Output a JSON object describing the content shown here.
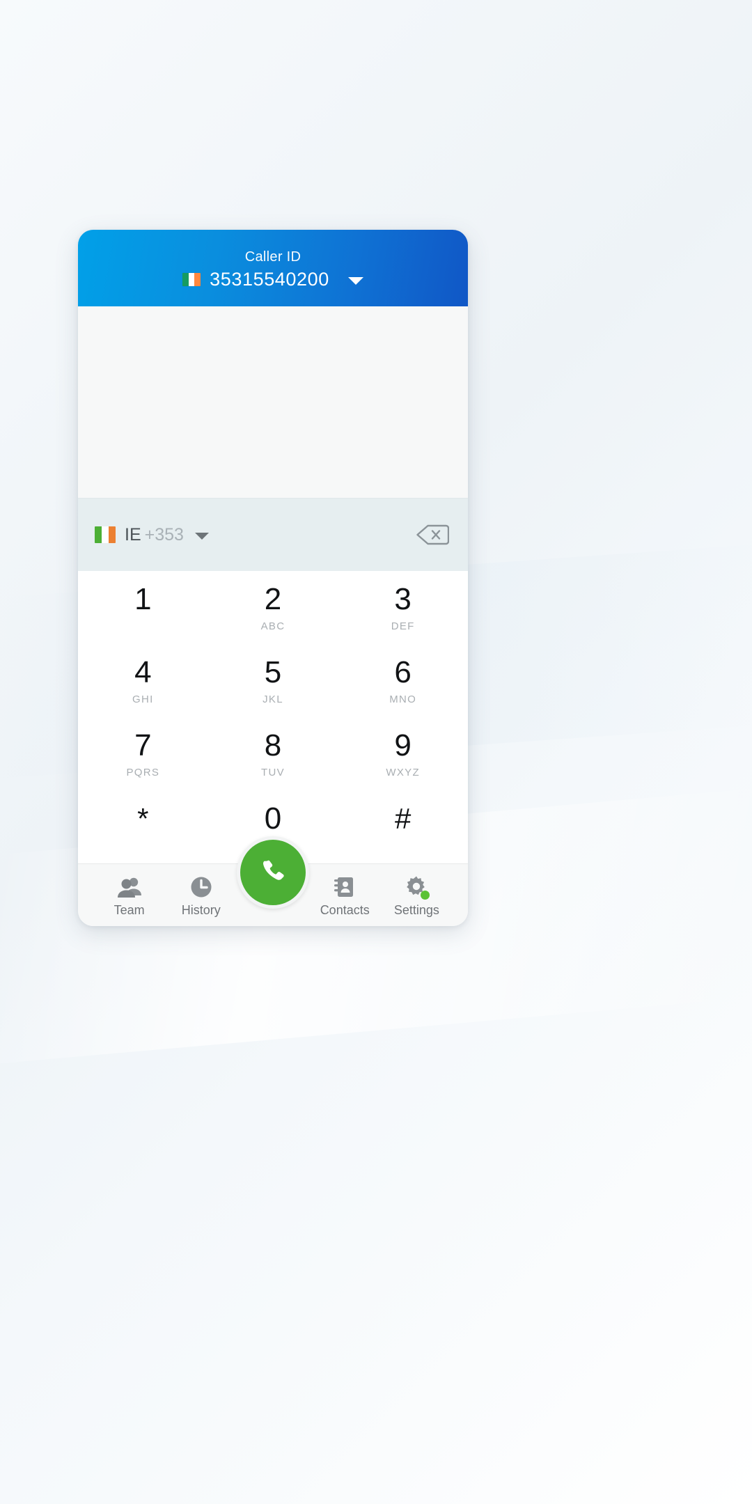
{
  "header": {
    "caller_id_label": "Caller ID",
    "caller_id_number": "35315540200",
    "flag_icon": "flag-ireland-icon",
    "dropdown_icon": "chevron-down-icon",
    "gradient_from": "#01a0e8",
    "gradient_to": "#1057c6"
  },
  "display": {
    "entered_number": "",
    "background": "#f7f8f8"
  },
  "country_row": {
    "flag_icon": "flag-ireland-icon",
    "country_code": "IE",
    "dial_code": "+353",
    "dropdown_icon": "chevron-down-icon",
    "backspace_icon": "backspace-icon",
    "background": "#e6eef0"
  },
  "keypad": {
    "keys": [
      {
        "digit": "1",
        "letters": ""
      },
      {
        "digit": "2",
        "letters": "ABC"
      },
      {
        "digit": "3",
        "letters": "DEF"
      },
      {
        "digit": "4",
        "letters": "GHI"
      },
      {
        "digit": "5",
        "letters": "JKL"
      },
      {
        "digit": "6",
        "letters": "MNO"
      },
      {
        "digit": "7",
        "letters": "PQRS"
      },
      {
        "digit": "8",
        "letters": "TUV"
      },
      {
        "digit": "9",
        "letters": "WXYZ"
      },
      {
        "digit": "*",
        "letters": ""
      },
      {
        "digit": "0",
        "letters": ""
      },
      {
        "digit": "#",
        "letters": ""
      }
    ]
  },
  "navbar": {
    "items": [
      {
        "label": "Team",
        "icon": "people-icon"
      },
      {
        "label": "History",
        "icon": "clock-icon"
      },
      {
        "label": "Contacts",
        "icon": "address-book-icon"
      },
      {
        "label": "Settings",
        "icon": "gear-icon",
        "badge": true
      }
    ],
    "call_button": {
      "icon": "phone-icon",
      "color": "#4caf35"
    },
    "badge_color": "#5bc236"
  }
}
